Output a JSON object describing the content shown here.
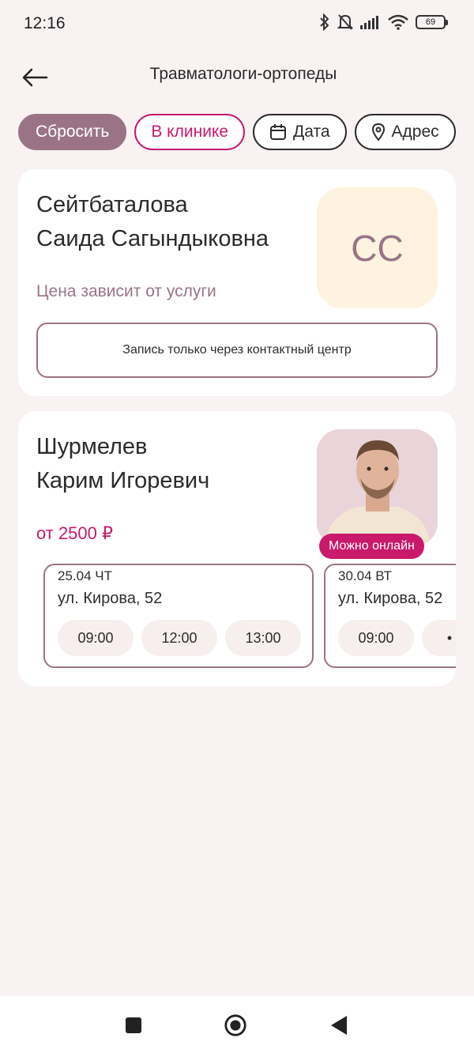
{
  "status": {
    "time": "12:16",
    "battery": "69"
  },
  "header": {
    "title": "Травматологи-ортопеды"
  },
  "filters": {
    "reset": "Сбросить",
    "clinic": "В клинике",
    "date": "Дата",
    "address": "Адрес"
  },
  "doctors": [
    {
      "name_line1": "Сейтбаталова",
      "name_line2": "Саида Сагындыковна",
      "initials": "СС",
      "price": "Цена зависит от услуги",
      "contact_button": "Запись только через контактный центр"
    },
    {
      "name_line1": "Шурмелев",
      "name_line2": "Карим Игоревич",
      "price": "от 2500 ₽",
      "badge": "Можно онлайн",
      "slots": [
        {
          "date": "25.04 ЧТ",
          "address": "ул. Кирова, 52",
          "times": [
            "09:00",
            "12:00",
            "13:00"
          ]
        },
        {
          "date": "30.04 ВТ",
          "address": "ул. Кирова, 52",
          "times": [
            "09:00",
            "•"
          ]
        }
      ]
    }
  ],
  "colors": {
    "accent": "#c9196b",
    "muted": "#9a7486",
    "background": "#f8f2f2"
  }
}
